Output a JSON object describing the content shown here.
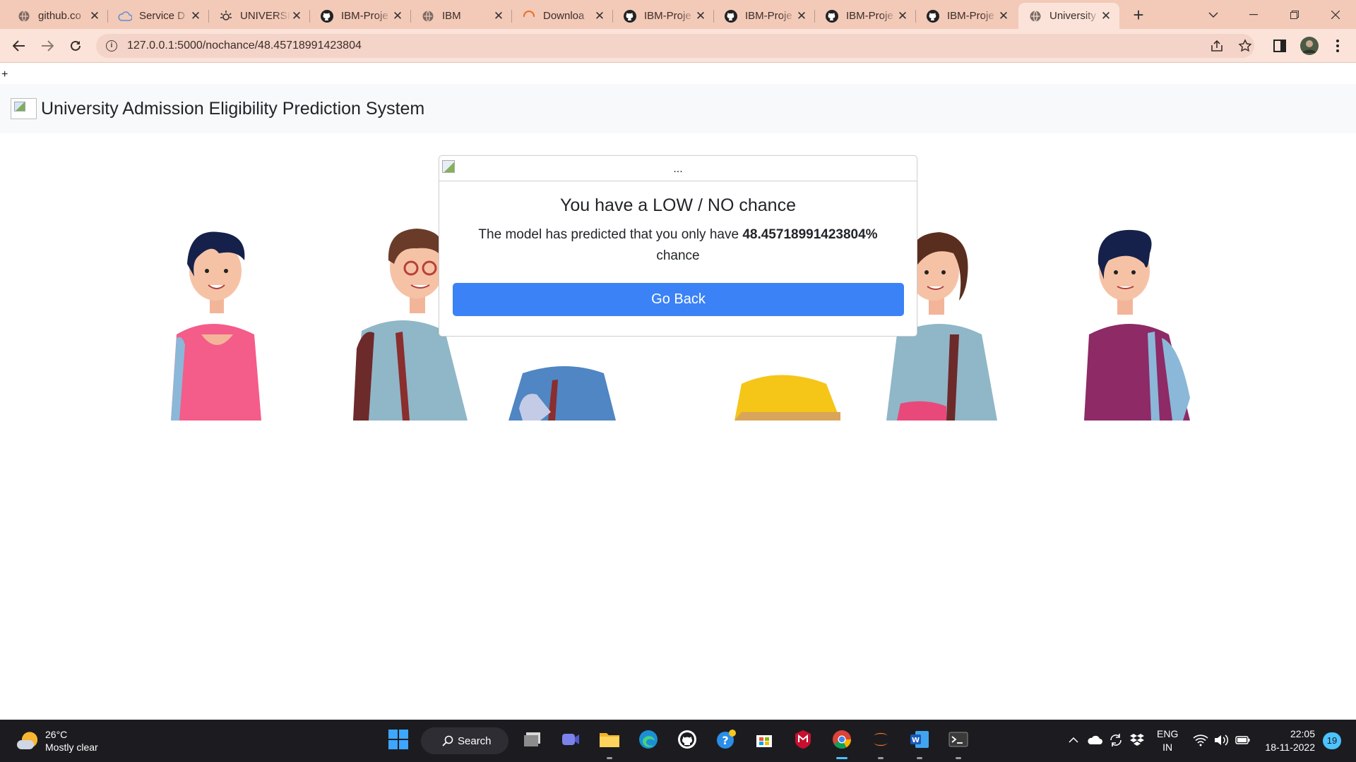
{
  "browser": {
    "tabs": [
      {
        "title": "github.co",
        "icon": "globe-icon"
      },
      {
        "title": "Service D",
        "icon": "cloud-icon"
      },
      {
        "title": "UNIVERSI",
        "icon": "ibm-bee-icon"
      },
      {
        "title": "IBM-Proje",
        "icon": "github-icon"
      },
      {
        "title": "IBM",
        "icon": "globe-icon"
      },
      {
        "title": "Downloa",
        "icon": "loading-icon"
      },
      {
        "title": "IBM-Proje",
        "icon": "github-icon"
      },
      {
        "title": "IBM-Proje",
        "icon": "github-icon"
      },
      {
        "title": "IBM-Proje",
        "icon": "github-icon"
      },
      {
        "title": "IBM-Proje",
        "icon": "github-icon"
      },
      {
        "title": "University",
        "icon": "globe-icon",
        "active": true
      }
    ],
    "url": "127.0.0.1:5000/nochance/48.45718991423804",
    "accent_color": "#fbe3d9"
  },
  "page": {
    "stray_text": "+",
    "navbar": {
      "brand_name": "University Admission Eligibility Prediction System"
    },
    "card": {
      "image_alt": "...",
      "title": "You have a LOW / NO chance",
      "text_before": "The model has predicted that you only have ",
      "probability": "48.45718991423804%",
      "text_after": " chance",
      "button_label": "Go Back",
      "button_color": "#3b82f6"
    }
  },
  "taskbar": {
    "weather": {
      "temperature": "26°C",
      "condition": "Mostly clear"
    },
    "search_label": "Search",
    "language": {
      "line1": "ENG",
      "line2": "IN"
    },
    "clock": {
      "time": "22:05",
      "date": "18-11-2022"
    },
    "notification_count": "19"
  }
}
